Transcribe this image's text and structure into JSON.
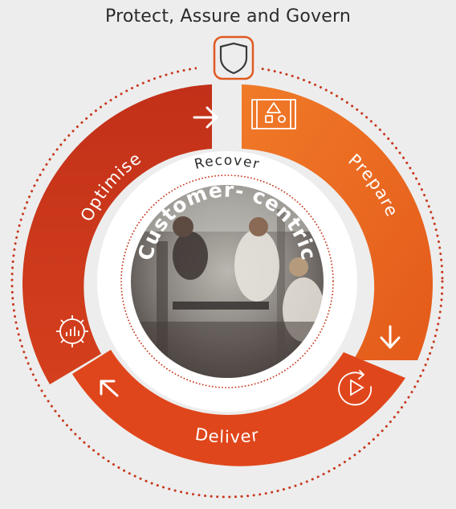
{
  "title": "Protect, Assure and Govern",
  "center_label": "Customer- centric",
  "inner_ring_label": "Recover",
  "segments": [
    {
      "label": "Optimise",
      "icon": "gear-chart-icon",
      "arrow": "arrow-right-icon"
    },
    {
      "label": "Prepare",
      "icon": "blueprint-icon",
      "arrow": "arrow-down-right-icon"
    },
    {
      "label": "Deliver",
      "icon": "play-circle-icon",
      "arrow": "arrow-up-left-icon"
    }
  ],
  "top_icon": "shield-icon",
  "center_image": "team-meeting-photo",
  "colors": {
    "background": "#ededed",
    "optimise": "#c9361b",
    "prepare": "#ec6a1f",
    "deliver": "#e0461b",
    "dots": "#c8381e",
    "title": "#2b2b2b"
  }
}
